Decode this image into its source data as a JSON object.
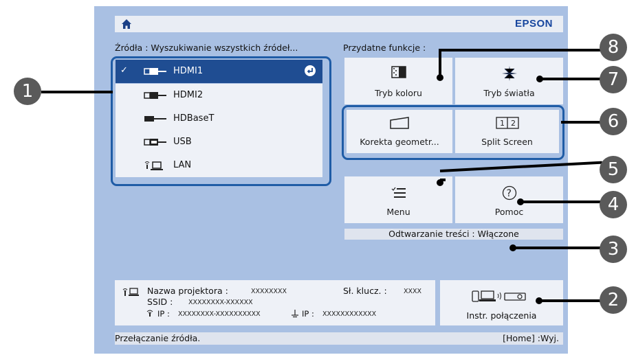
{
  "header": {
    "brand": "EPSON"
  },
  "sources": {
    "label": "Źródła : Wyszukiwanie wszystkich źródeł...",
    "items": [
      {
        "name": "HDMI1",
        "icon": "hdmi-icon",
        "selected": true
      },
      {
        "name": "HDMI2",
        "icon": "hdmi-icon",
        "selected": false
      },
      {
        "name": "HDBaseT",
        "icon": "hdbaset-icon",
        "selected": false
      },
      {
        "name": "USB",
        "icon": "usb-icon",
        "selected": false
      },
      {
        "name": "LAN",
        "icon": "lan-icon",
        "selected": false
      }
    ]
  },
  "functions": {
    "label": "Przydatne funkcje :",
    "tiles": [
      {
        "label": "Tryb koloru",
        "icon": "color-mode-icon"
      },
      {
        "label": "Tryb światła",
        "icon": "light-mode-icon"
      },
      {
        "label": "Korekta geometr...",
        "icon": "geometry-icon"
      },
      {
        "label": "Split Screen",
        "icon": "split-screen-icon"
      },
      {
        "label": "Menu",
        "icon": "menu-icon"
      },
      {
        "label": "Pomoc",
        "icon": "help-icon"
      }
    ]
  },
  "content_playback": "Odtwarzanie treści  :  Włączone",
  "info": {
    "projector_name_label": "Nazwa projektora :",
    "projector_name_value": "XXXXXXXX",
    "keyword_label": "Sł. klucz. :",
    "keyword_value": "XXXX",
    "ssid_label": "SSID  :",
    "ssid_value": "XXXXXXXX-XXXXXX",
    "ip_label": "IP :",
    "ip_value": "XXXXXXXX-XXXXXXXXXX",
    "ip2_label": "IP :",
    "ip2_value": "XXXXXXXXXXXX"
  },
  "connection": {
    "label": "Instr. połączenia"
  },
  "footer": {
    "left": "Przełączanie źródła.",
    "right": "[Home] :Wyj."
  },
  "callouts": [
    "1",
    "2",
    "3",
    "4",
    "5",
    "6",
    "7",
    "8"
  ]
}
